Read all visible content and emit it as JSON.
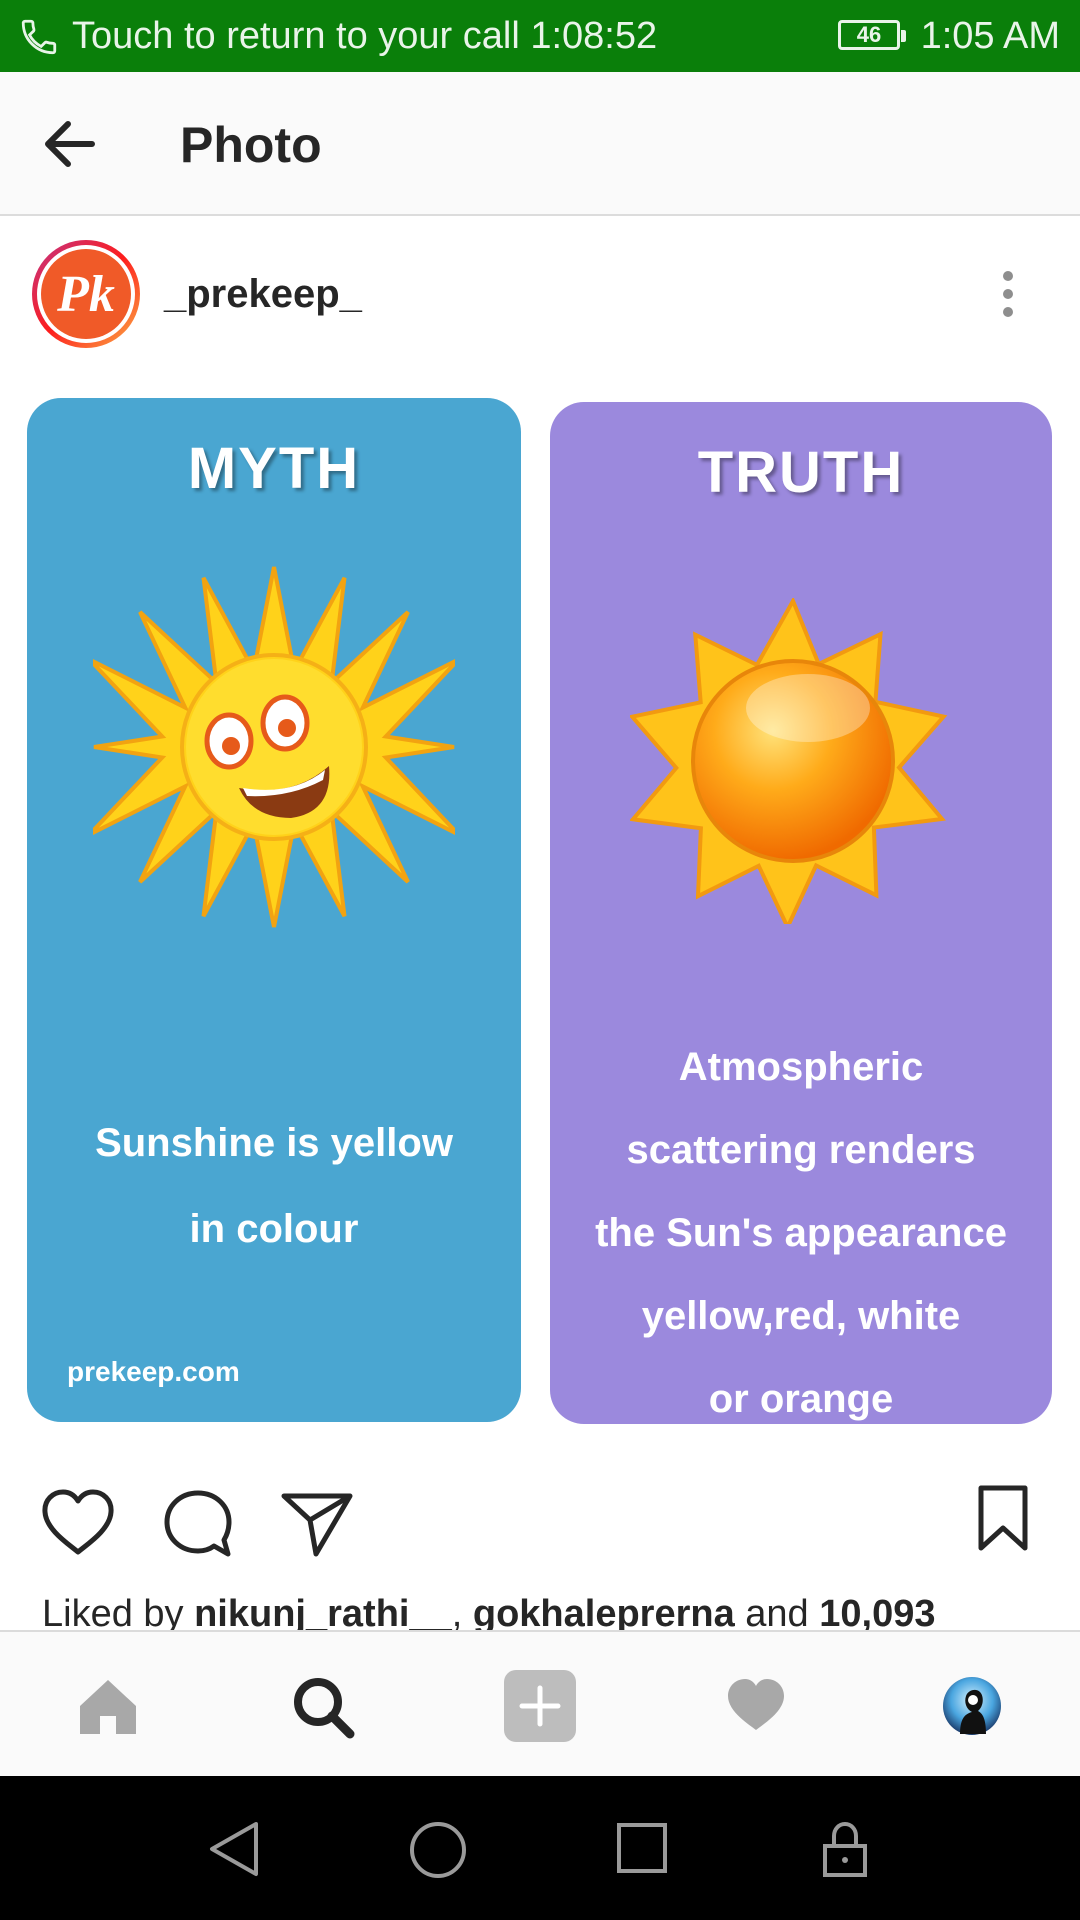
{
  "status_bar": {
    "call_text": "Touch to return to your call 1:08:52",
    "battery": "46",
    "time": "1:05 AM",
    "background": "#0a7f0a"
  },
  "app_bar": {
    "title": "Photo",
    "back_icon": "arrow-left-icon"
  },
  "post": {
    "username": "_prekeep_",
    "avatar_text": "Pk",
    "more_icon": "more-vertical-icon",
    "image": {
      "myth": {
        "heading": "MYTH",
        "text_line1": "Sunshine is yellow",
        "text_line2": "in colour",
        "watermark": "prekeep.com",
        "color": "#4aa6d1"
      },
      "truth": {
        "heading": "TRUTH",
        "text_line1": "Atmospheric",
        "text_line2": "scattering renders",
        "text_line3": "the Sun's appearance",
        "text_line4": "yellow,red, white",
        "text_line5": "or orange",
        "color": "#9b89dd"
      }
    },
    "actions": {
      "like_icon": "heart-outline-icon",
      "comment_icon": "comment-icon",
      "share_icon": "send-icon",
      "save_icon": "bookmark-icon"
    },
    "likes": {
      "prefix": "Liked by ",
      "user1": "nikunj_rathi__",
      "separator": ", ",
      "user2": "gokhaleprerna",
      "and_text": " and ",
      "count": "10,093"
    }
  },
  "bottom_nav": {
    "items": [
      "home-icon",
      "search-icon",
      "add-icon",
      "activity-heart-icon",
      "profile-avatar"
    ]
  },
  "system_nav": {
    "items": [
      "back-triangle-icon",
      "home-circle-icon",
      "recents-square-icon",
      "lock-icon"
    ]
  }
}
